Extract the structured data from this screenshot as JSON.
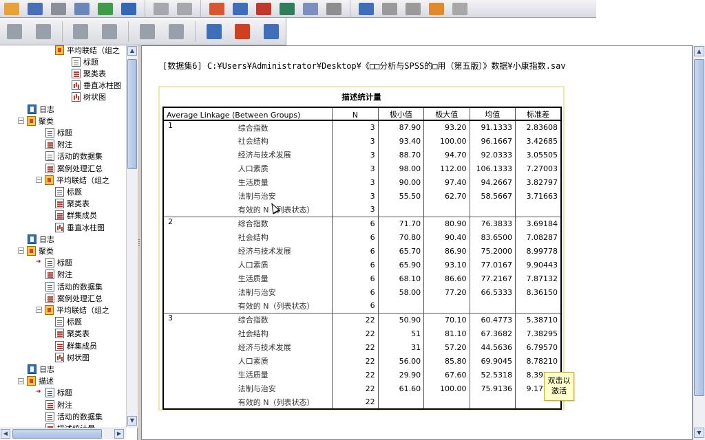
{
  "content": {
    "path": "[数据集6] C:¥Users¥Administrator¥Desktop¥《□□分析与SPSS的□用（第五版）》数据¥小康指数.sav"
  },
  "table": {
    "title": "描述统计量",
    "headers": {
      "group_col": "Average Linkage (Between Groups)",
      "n": "N",
      "min": "极小值",
      "max": "极大值",
      "mean": "均值",
      "std": "标准差"
    },
    "groups": [
      {
        "label": "1",
        "rows": [
          {
            "var": "综合指数",
            "n": "3",
            "min": "87.90",
            "max": "93.20",
            "mean": "91.1333",
            "std": "2.83608"
          },
          {
            "var": "社会结构",
            "n": "3",
            "min": "93.40",
            "max": "100.00",
            "mean": "96.1667",
            "std": "3.42685"
          },
          {
            "var": "经济与技术发展",
            "n": "3",
            "min": "88.70",
            "max": "94.70",
            "mean": "92.0333",
            "std": "3.05505"
          },
          {
            "var": "人口素质",
            "n": "3",
            "min": "98.00",
            "max": "112.00",
            "mean": "106.1333",
            "std": "7.27003"
          },
          {
            "var": "生活质量",
            "n": "3",
            "min": "90.00",
            "max": "97.40",
            "mean": "94.2667",
            "std": "3.82797"
          },
          {
            "var": "法制与治安",
            "n": "3",
            "min": "55.50",
            "max": "62.70",
            "mean": "58.5667",
            "std": "3.71663"
          },
          {
            "var": "有效的 N（列表状态）",
            "n": "3",
            "min": "",
            "max": "",
            "mean": "",
            "std": ""
          }
        ]
      },
      {
        "label": "2",
        "rows": [
          {
            "var": "综合指数",
            "n": "6",
            "min": "71.70",
            "max": "80.90",
            "mean": "76.3833",
            "std": "3.69184"
          },
          {
            "var": "社会结构",
            "n": "6",
            "min": "70.80",
            "max": "90.40",
            "mean": "83.6500",
            "std": "7.08287"
          },
          {
            "var": "经济与技术发展",
            "n": "6",
            "min": "65.70",
            "max": "86.90",
            "mean": "75.2000",
            "std": "8.99778"
          },
          {
            "var": "人口素质",
            "n": "6",
            "min": "65.90",
            "max": "93.10",
            "mean": "77.0167",
            "std": "9.90443"
          },
          {
            "var": "生活质量",
            "n": "6",
            "min": "68.10",
            "max": "86.60",
            "mean": "77.2167",
            "std": "7.87132"
          },
          {
            "var": "法制与治安",
            "n": "6",
            "min": "58.00",
            "max": "77.20",
            "mean": "66.5333",
            "std": "8.36150"
          },
          {
            "var": "有效的 N（列表状态）",
            "n": "6",
            "min": "",
            "max": "",
            "mean": "",
            "std": ""
          }
        ]
      },
      {
        "label": "3",
        "rows": [
          {
            "var": "综合指数",
            "n": "22",
            "min": "50.90",
            "max": "70.10",
            "mean": "60.4773",
            "std": "5.38710"
          },
          {
            "var": "社会结构",
            "n": "22",
            "min": "51",
            "max": "81.10",
            "mean": "67.3682",
            "std": "7.38295"
          },
          {
            "var": "经济与技术发展",
            "n": "22",
            "min": "31",
            "max": "57.20",
            "mean": "44.5636",
            "std": "6.79570"
          },
          {
            "var": "人口素质",
            "n": "22",
            "min": "56.00",
            "max": "85.80",
            "mean": "69.9045",
            "std": "8.78210"
          },
          {
            "var": "生活质量",
            "n": "22",
            "min": "29.90",
            "max": "67.60",
            "mean": "52.5318",
            "std": "8.39282"
          },
          {
            "var": "法制与治安",
            "n": "22",
            "min": "61.60",
            "max": "100.00",
            "mean": "75.9136",
            "std": "9.17280"
          },
          {
            "var": "有效的 N（列表状态）",
            "n": "22",
            "min": "",
            "max": "",
            "mean": "",
            "std": ""
          }
        ]
      }
    ]
  },
  "tooltip": {
    "line1": "双击以",
    "line2": "激活"
  },
  "nav": {
    "items": [
      {
        "label": "平均联结（组之",
        "icon": "group",
        "indent": 3
      },
      {
        "label": "标题",
        "icon": "doc",
        "indent": 4
      },
      {
        "label": "聚类表",
        "icon": "table",
        "indent": 4
      },
      {
        "label": "垂直冰柱图",
        "icon": "chart",
        "indent": 4
      },
      {
        "label": "树状图",
        "icon": "chart",
        "indent": 4
      },
      {
        "label": "日志",
        "icon": "book",
        "indent": 1
      },
      {
        "label": "聚类",
        "icon": "group",
        "indent": 1,
        "expander": "−"
      },
      {
        "label": "标题",
        "icon": "doc",
        "indent": 2
      },
      {
        "label": "附注",
        "icon": "table",
        "indent": 2
      },
      {
        "label": "活动的数据集",
        "icon": "doc",
        "indent": 2
      },
      {
        "label": "案例处理汇总",
        "icon": "table",
        "indent": 2
      },
      {
        "label": "平均联结（组之",
        "icon": "group",
        "indent": 2,
        "expander": "−"
      },
      {
        "label": "标题",
        "icon": "doc",
        "indent": 3
      },
      {
        "label": "聚类表",
        "icon": "table",
        "indent": 3
      },
      {
        "label": "群集成员",
        "icon": "table",
        "indent": 3
      },
      {
        "label": "垂直冰柱图",
        "icon": "chart",
        "indent": 3
      },
      {
        "label": "日志",
        "icon": "book",
        "indent": 1
      },
      {
        "label": "聚类",
        "icon": "group",
        "indent": 1,
        "expander": "−"
      },
      {
        "label": "标题",
        "icon": "doc",
        "indent": 2,
        "arrow": true
      },
      {
        "label": "附注",
        "icon": "table",
        "indent": 2
      },
      {
        "label": "活动的数据集",
        "icon": "doc",
        "indent": 2
      },
      {
        "label": "案例处理汇总",
        "icon": "table",
        "indent": 2
      },
      {
        "label": "平均联结（组之",
        "icon": "group",
        "indent": 2,
        "expander": "−"
      },
      {
        "label": "标题",
        "icon": "doc",
        "indent": 3
      },
      {
        "label": "聚类表",
        "icon": "table",
        "indent": 3
      },
      {
        "label": "群集成员",
        "icon": "table",
        "indent": 3
      },
      {
        "label": "树状图",
        "icon": "chart",
        "indent": 3
      },
      {
        "label": "日志",
        "icon": "book",
        "indent": 1
      },
      {
        "label": "描述",
        "icon": "group",
        "indent": 1,
        "expander": "−"
      },
      {
        "label": "标题",
        "icon": "doc",
        "indent": 2,
        "arrow": true
      },
      {
        "label": "附注",
        "icon": "table",
        "indent": 2
      },
      {
        "label": "活动的数据集",
        "icon": "doc",
        "indent": 2
      },
      {
        "label": "描述统计量",
        "icon": "table",
        "indent": 2
      }
    ]
  },
  "toolbar1": [
    {
      "name": "open-icon",
      "color": "#e8a23a"
    },
    {
      "name": "save-icon",
      "color": "#4a6fb8"
    },
    {
      "name": "print-icon",
      "color": "#8a8f99"
    },
    {
      "name": "print-preview-icon",
      "color": "#6b86b8"
    },
    {
      "name": "export-icon",
      "color": "#3f9a4a"
    },
    {
      "name": "recall-dialog-icon",
      "color": "#3568b2"
    },
    {
      "name": "undo-icon",
      "color": "#a6a8ae"
    },
    {
      "name": "redo-icon",
      "color": "#a6a8ae"
    },
    {
      "name": "goto-data-icon",
      "color": "#d9572e"
    },
    {
      "name": "goto-case-icon",
      "color": "#3f6fba"
    },
    {
      "name": "goto-variable-icon",
      "color": "#c0392b"
    },
    {
      "name": "variables-icon",
      "color": "#2f7d5a"
    },
    {
      "name": "use-sets-icon",
      "color": "#7c8fbe"
    },
    {
      "name": "show-all-icon",
      "color": "#8e8e8e"
    },
    {
      "name": "run-icon",
      "color": "#3f6fba"
    },
    {
      "name": "designate-window-icon",
      "color": "#9a9a9a"
    },
    {
      "name": "pivot-icon",
      "color": "#9a9a9a"
    },
    {
      "name": "script-icon",
      "color": "#e08a2a"
    },
    {
      "name": "blank-icon",
      "color": "#a8a8a8"
    }
  ],
  "toolbar2": [
    {
      "name": "promote-icon",
      "color": "#9aa0aa"
    },
    {
      "name": "demote-icon",
      "color": "#9aa0aa"
    },
    {
      "name": "expand-icon",
      "color": "#9aa0aa"
    },
    {
      "name": "collapse-icon",
      "color": "#9aa0aa"
    },
    {
      "name": "show-icon",
      "color": "#9aa0aa"
    },
    {
      "name": "hide-icon",
      "color": "#9aa0aa"
    },
    {
      "name": "insert-heading-icon",
      "color": "#3f6fba"
    },
    {
      "name": "insert-title-icon",
      "color": "#d04020"
    },
    {
      "name": "insert-text-icon",
      "color": "#3f6fba"
    }
  ]
}
